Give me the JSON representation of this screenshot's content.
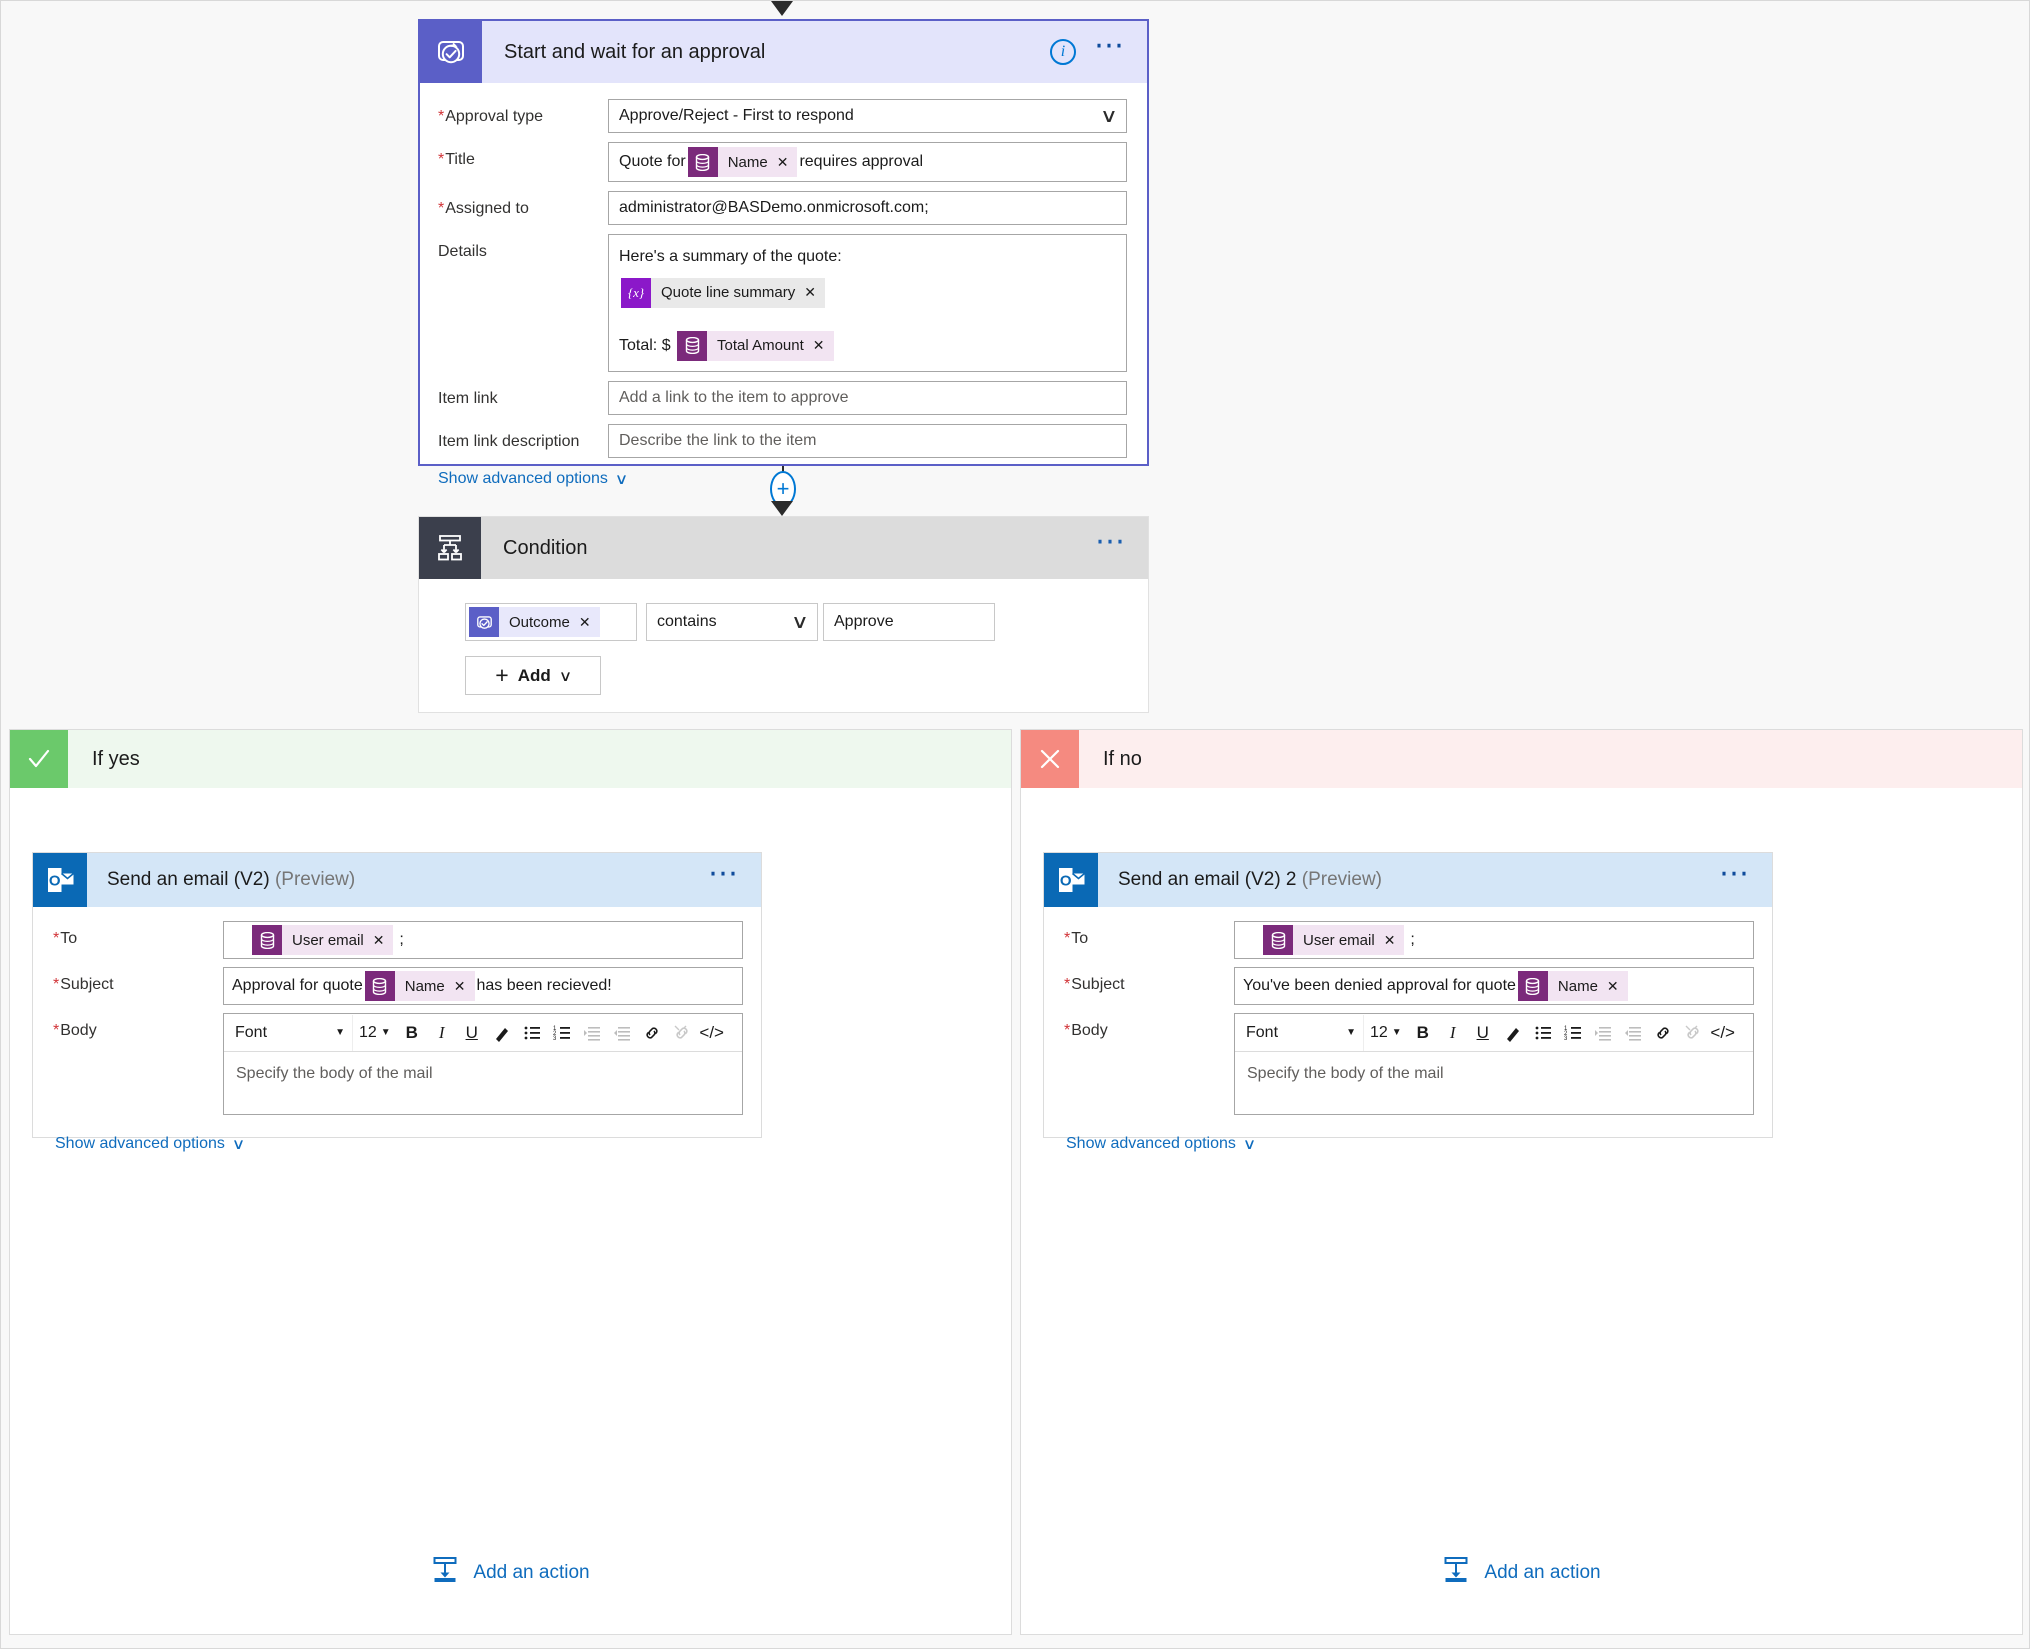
{
  "approval": {
    "title": "Start and wait for an approval",
    "icon": "approvals-icon",
    "info_icon": "info-icon",
    "menu_icon": "ellipsis-menu-icon",
    "fields": {
      "approval_type": {
        "label": "Approval type",
        "required": true,
        "value": "Approve/Reject - First to respond"
      },
      "title": {
        "label": "Title",
        "required": true,
        "prefix": "Quote for",
        "token": "Name",
        "suffix": "requires approval"
      },
      "assigned_to": {
        "label": "Assigned to",
        "required": true,
        "value": "administrator@BASDemo.onmicrosoft.com;"
      },
      "details": {
        "label": "Details",
        "required": false,
        "line1": "Here's a summary of the quote:",
        "token1": "Quote line summary",
        "line2_prefix": "Total: $",
        "token2": "Total Amount"
      },
      "item_link": {
        "label": "Item link",
        "required": false,
        "placeholder": "Add a link to the item to approve"
      },
      "item_link_description": {
        "label": "Item link description",
        "required": false,
        "placeholder": "Describe the link to the item"
      }
    },
    "advanced_label": "Show advanced options"
  },
  "add_node": {
    "label": "+"
  },
  "condition": {
    "title": "Condition",
    "icon": "condition-branch-icon",
    "menu_icon": "ellipsis-menu-icon",
    "left_token": "Outcome",
    "operator": "contains",
    "value": "Approve",
    "add_label": "Add"
  },
  "branches": {
    "yes": {
      "label": "If yes",
      "icon": "check-icon",
      "add_action_label": "Add an action",
      "email": {
        "title": "Send an email (V2)",
        "preview": "(Preview)",
        "icon": "outlook-icon",
        "menu_icon": "ellipsis-menu-icon",
        "to": {
          "label": "To",
          "token": "User email",
          "suffix": ";"
        },
        "subject": {
          "label": "Subject",
          "prefix": "Approval for quote",
          "token": "Name",
          "suffix": "has been recieved!"
        },
        "body": {
          "label": "Body",
          "font_label": "Font",
          "size_label": "12",
          "placeholder": "Specify the body of the mail"
        },
        "advanced_label": "Show advanced options"
      }
    },
    "no": {
      "label": "If no",
      "icon": "cross-icon",
      "add_action_label": "Add an action",
      "email": {
        "title": "Send an email (V2) 2",
        "preview": "(Preview)",
        "icon": "outlook-icon",
        "menu_icon": "ellipsis-menu-icon",
        "to": {
          "label": "To",
          "token": "User email",
          "suffix": ";"
        },
        "subject": {
          "label": "Subject",
          "prefix": "You've been denied approval for quote",
          "token": "Name",
          "suffix": ""
        },
        "body": {
          "label": "Body",
          "font_label": "Font",
          "size_label": "12",
          "placeholder": "Specify the body of the mail"
        },
        "advanced_label": "Show advanced options"
      }
    }
  },
  "rte_buttons": [
    {
      "name": "bold-icon",
      "glyph": "B",
      "disabled": false
    },
    {
      "name": "italic-icon",
      "glyph": "I",
      "disabled": false
    },
    {
      "name": "underline-icon",
      "glyph": "U",
      "disabled": false
    },
    {
      "name": "text-color-icon",
      "glyph": "pen",
      "disabled": false
    },
    {
      "name": "bulleted-list-icon",
      "glyph": "ul",
      "disabled": false
    },
    {
      "name": "numbered-list-icon",
      "glyph": "ol",
      "disabled": false
    },
    {
      "name": "indent-increase-icon",
      "glyph": "in",
      "disabled": true
    },
    {
      "name": "indent-decrease-icon",
      "glyph": "de",
      "disabled": true
    },
    {
      "name": "insert-link-icon",
      "glyph": "link",
      "disabled": false
    },
    {
      "name": "remove-link-icon",
      "glyph": "unlink",
      "disabled": true
    },
    {
      "name": "code-view-icon",
      "glyph": "</>",
      "disabled": false
    }
  ],
  "colors": {
    "approval_accent": "#5b5fc7",
    "approval_header_bg": "#e3e4fb",
    "condition_accent": "#3b3f4c",
    "outlook_accent": "#0a69b5",
    "outlook_header_bg": "#d4e6f7",
    "yes_accent": "#6bc96b",
    "no_accent": "#f58a80",
    "link": "#0f6cbd",
    "required": "#d13438",
    "dataverse_token": "#7b2a7b",
    "variable_token": "#8b18c9"
  }
}
